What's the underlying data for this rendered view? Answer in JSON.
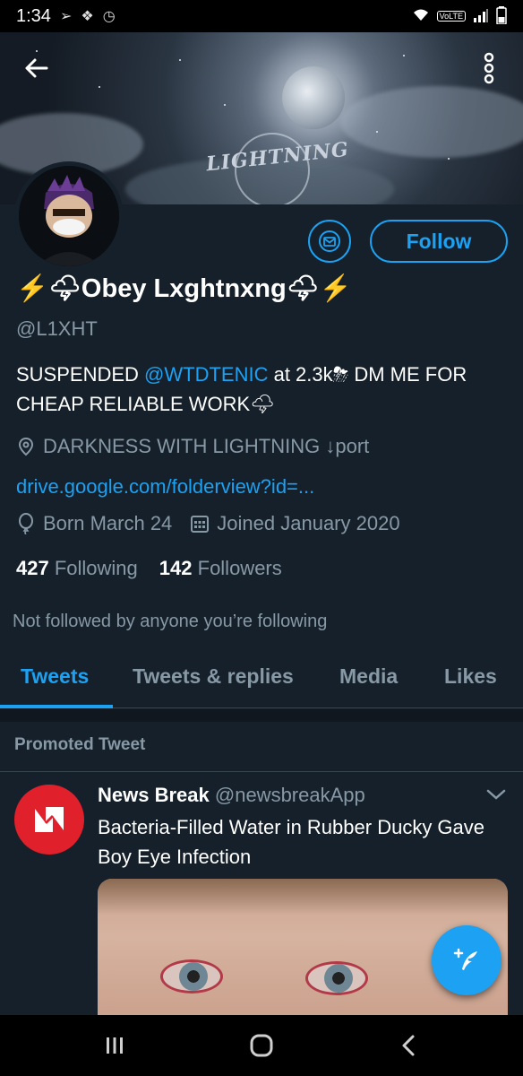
{
  "status_bar": {
    "time": "1:34",
    "network": "VoLTE"
  },
  "profile": {
    "display_name": "⚡🌩Obey Lxghtnxng🌩⚡",
    "handle": "@L1XHT",
    "banner_text": "LIGHTNING",
    "follow_label": "Follow",
    "bio_part1": "SUSPENDED ",
    "bio_mention": "@WTDTENIC",
    "bio_part2": " at  2.3k⛈  DM ME FOR CHEAP RELIABLE WORK🌩",
    "location": "DARKNESS WITH LIGHTNING ↓port",
    "website": "drive.google.com/folderview?id=...",
    "birthday": "Born March 24",
    "joined": "Joined January 2020",
    "following_count": "427",
    "following_label": "Following",
    "followers_count": "142",
    "followers_label": "Followers",
    "not_followed": "Not followed by anyone you’re following"
  },
  "tabs": [
    {
      "label": "Tweets",
      "active": true
    },
    {
      "label": "Tweets & replies",
      "active": false
    },
    {
      "label": "Media",
      "active": false
    },
    {
      "label": "Likes",
      "active": false
    }
  ],
  "promoted_label": "Promoted Tweet",
  "tweet": {
    "author": "News Break",
    "handle": "@newsbreakApp",
    "text": "Bacteria-Filled Water in Rubber Ducky Gave Boy Eye Infection"
  },
  "icons": {
    "back": "arrow-left-icon",
    "more": "more-vertical-icon",
    "mail": "envelope-icon",
    "location": "location-pin-icon",
    "birthday": "balloon-icon",
    "calendar": "calendar-icon",
    "compose": "compose-feather-icon"
  },
  "colors": {
    "accent": "#1da1f2",
    "background": "#15202b",
    "secondary_text": "#8899a6",
    "news_break_red": "#e0202b"
  }
}
